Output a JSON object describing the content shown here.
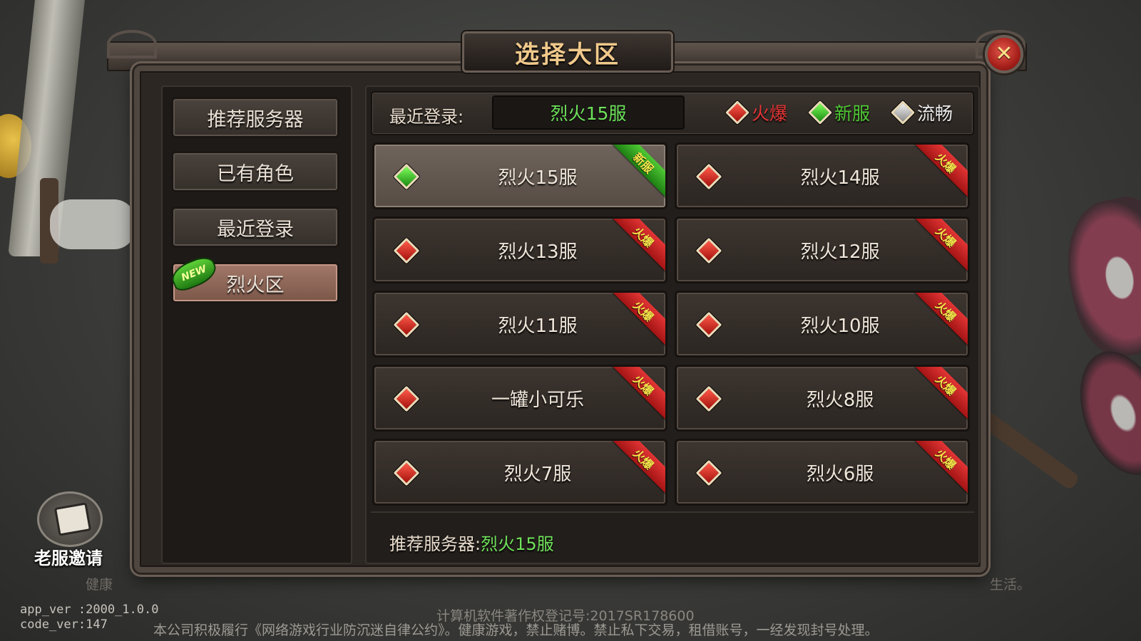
{
  "title": "选择大区",
  "close_icon": "✕",
  "nav": [
    {
      "label": "推荐服务器",
      "active": false
    },
    {
      "label": "已有角色",
      "active": false
    },
    {
      "label": "最近登录",
      "active": false
    },
    {
      "label": "烈火区",
      "active": true,
      "badge": "NEW"
    }
  ],
  "recent": {
    "label": "最近登录:",
    "value": "烈火15服"
  },
  "legend": [
    {
      "label": "火爆",
      "color": "#e23535"
    },
    {
      "label": "新服",
      "color": "#4fc934"
    },
    {
      "label": "流畅",
      "color": "#e8e8e8"
    }
  ],
  "servers": [
    {
      "name": "烈火15服",
      "status": "新服",
      "selected": true
    },
    {
      "name": "烈火14服",
      "status": "火爆"
    },
    {
      "name": "烈火13服",
      "status": "火爆"
    },
    {
      "name": "烈火12服",
      "status": "火爆"
    },
    {
      "name": "烈火11服",
      "status": "火爆"
    },
    {
      "name": "烈火10服",
      "status": "火爆"
    },
    {
      "name": "一罐小可乐",
      "status": "火爆"
    },
    {
      "name": "烈火8服",
      "status": "火爆"
    },
    {
      "name": "烈火7服",
      "status": "火爆"
    },
    {
      "name": "烈火6服",
      "status": "火爆"
    }
  ],
  "recommend": {
    "label": "推荐服务器:",
    "value": "烈火15服"
  },
  "invite": {
    "label": "老服邀请",
    "icon": "envelope-icon"
  },
  "footer": {
    "left_fragment": "健康",
    "right_fragment": "生活。",
    "copyright_reg": "计算机软件著作权登记号:2017SR178600",
    "app_ver": "app_ver  :2000_1.0.0",
    "code_ver": "code_ver:147",
    "notice": "本公司积极履行《网络游戏行业防沉迷自律公约》。健康游戏，禁止赌博。禁止私下交易，租借账号，一经发现封号处理。"
  }
}
